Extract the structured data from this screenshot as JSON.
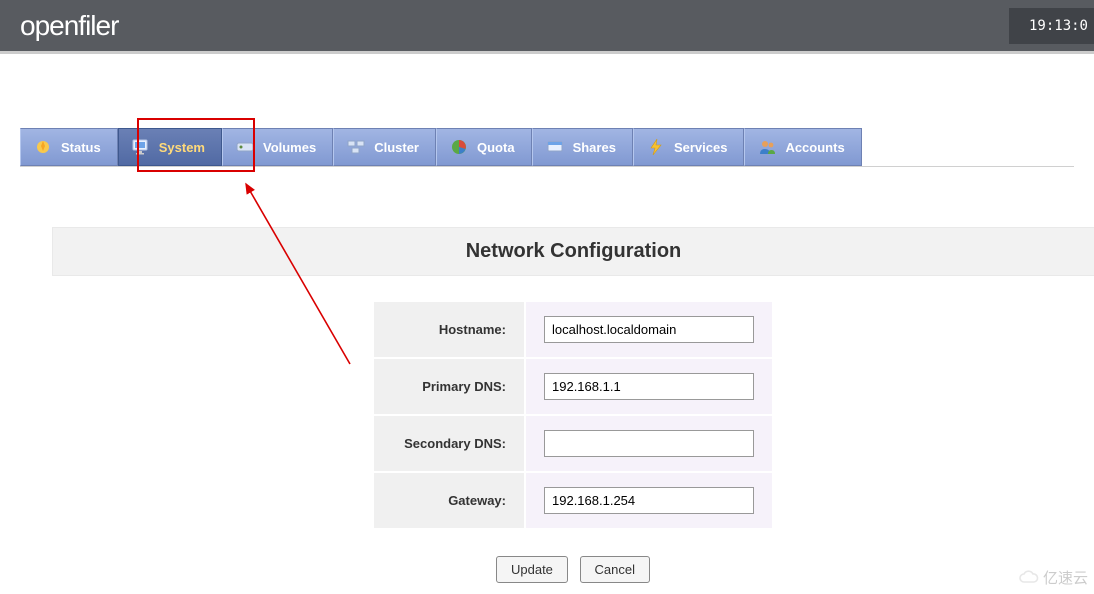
{
  "header": {
    "logo": "openfiler",
    "clock": "19:13:0"
  },
  "tabs": [
    {
      "id": "status",
      "label": "Status"
    },
    {
      "id": "system",
      "label": "System"
    },
    {
      "id": "volumes",
      "label": "Volumes"
    },
    {
      "id": "cluster",
      "label": "Cluster"
    },
    {
      "id": "quota",
      "label": "Quota"
    },
    {
      "id": "shares",
      "label": "Shares"
    },
    {
      "id": "services",
      "label": "Services"
    },
    {
      "id": "accounts",
      "label": "Accounts"
    }
  ],
  "active_tab": "system",
  "panel": {
    "title": "Network Configuration",
    "fields": {
      "hostname": {
        "label": "Hostname:",
        "value": "localhost.localdomain"
      },
      "primary_dns": {
        "label": "Primary DNS:",
        "value": "192.168.1.1"
      },
      "secondary_dns": {
        "label": "Secondary DNS:",
        "value": ""
      },
      "gateway": {
        "label": "Gateway:",
        "value": "192.168.1.254"
      }
    },
    "buttons": {
      "update": "Update",
      "cancel": "Cancel"
    }
  },
  "watermark": "亿速云"
}
